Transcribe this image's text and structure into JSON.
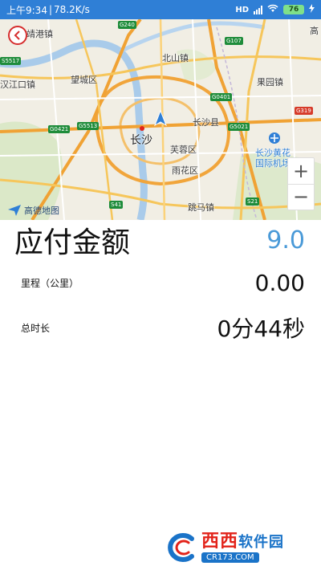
{
  "status_bar": {
    "time": "上午9:34",
    "speed": "78.2K/s",
    "network_badge": "HD",
    "battery": "76"
  },
  "map": {
    "labels": {
      "jinggang": "靖港镇",
      "beishan": "北山镇",
      "wangcheng": "望城区",
      "guoyuan": "果园镇",
      "hanjiangkou": "汉江口镇",
      "changsha_county": "长沙县",
      "changsha": "长沙",
      "furong": "芙蓉区",
      "airport_1": "长沙黄花",
      "airport_2": "国际机场",
      "yuhua": "雨花区",
      "tiaoma": "跳马镇",
      "edge_right": "高"
    },
    "shields": {
      "g240": "G240",
      "g107": "G107",
      "s5517": "S5517",
      "g0401": "G0401",
      "g319": "G319",
      "g0421": "G0421",
      "g5513": "G5513",
      "g5021": "G5021",
      "s41": "S41",
      "s21": "S21"
    },
    "logo_text": "高德地图",
    "zoom_in": "+",
    "zoom_out": "−"
  },
  "fare": {
    "title": "应付金额",
    "amount": "9.0"
  },
  "mileage": {
    "label": "里程（公里）",
    "value": "0.00"
  },
  "duration": {
    "label": "总时长",
    "value": "0分44秒"
  },
  "watermark": {
    "brand": "西西",
    "brand_suffix": "软件园",
    "site": "CR173.COM"
  },
  "colors": {
    "status_bar": "#2f7fd6",
    "fare_amount": "#4a9ad8",
    "back_button": "#d62d2d"
  }
}
